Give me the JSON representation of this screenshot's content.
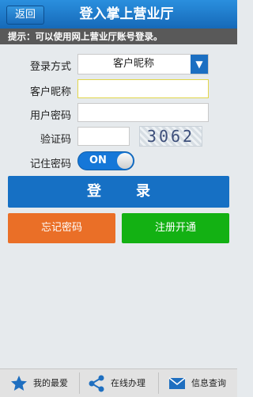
{
  "header": {
    "back_label": "返回",
    "title": "登入掌上营业厅"
  },
  "hint": "提示：可以使用网上营业厅账号登录。",
  "form": {
    "login_method_label": "登录方式",
    "login_method_value": "客户昵称",
    "nickname_label": "客户昵称",
    "nickname_value": "",
    "password_label": "用户密码",
    "password_value": "",
    "captcha_label": "验证码",
    "captcha_value": "",
    "captcha_text": "3062",
    "remember_label": "记住密码",
    "remember_toggle": "ON"
  },
  "buttons": {
    "login": "登录",
    "forgot": "忘记密码",
    "register": "注册开通"
  },
  "bottom_bar": {
    "tabs": [
      {
        "label": "我的最爱",
        "icon": "star-icon"
      },
      {
        "label": "在线办理",
        "icon": "share-icon"
      },
      {
        "label": "信息查询",
        "icon": "mail-icon"
      }
    ]
  },
  "colors": {
    "header": "#1b74c9",
    "primary": "#1670c4",
    "forgot": "#ea6f27",
    "register": "#13b113"
  }
}
